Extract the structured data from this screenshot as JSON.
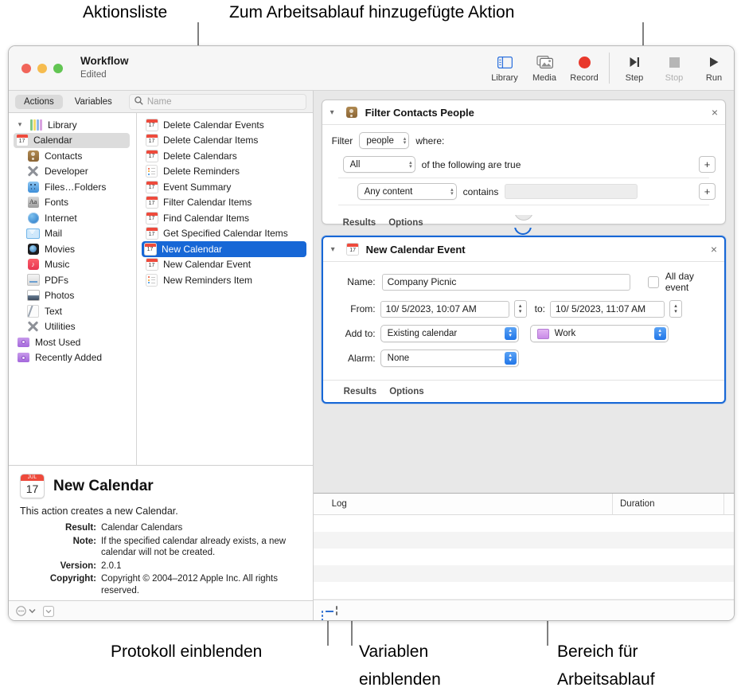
{
  "callouts": {
    "top_left": "Aktionsliste",
    "top_right": "Zum Arbeitsablauf hinzugefügte Aktion",
    "bottom_left": "Protokoll einblenden",
    "bottom_mid_line1": "Variablen",
    "bottom_mid_line2": "einblenden",
    "bottom_right_line1": "Bereich für",
    "bottom_right_line2": "Arbeitsablauf"
  },
  "window": {
    "title": "Workflow",
    "subtitle": "Edited",
    "traffic_lights": [
      "close-red",
      "minimize-yellow",
      "zoom-green"
    ],
    "toolbar": [
      {
        "label": "Library",
        "icon": "library-panel-icon",
        "disabled": false
      },
      {
        "label": "Media",
        "icon": "media-photos-icon",
        "disabled": false
      },
      {
        "label": "Record",
        "icon": "record-dot-icon",
        "disabled": false
      },
      {
        "label": "Step",
        "icon": "step-forward-icon",
        "disabled": false
      },
      {
        "label": "Stop",
        "icon": "stop-square-icon",
        "disabled": true
      },
      {
        "label": "Run",
        "icon": "play-triangle-icon",
        "disabled": false
      }
    ]
  },
  "library": {
    "tabs": [
      {
        "label": "Actions",
        "active": true
      },
      {
        "label": "Variables",
        "active": false
      }
    ],
    "search_placeholder": "Name",
    "search_value": "",
    "categories": [
      {
        "label": "Library",
        "icon": "library-books-icon",
        "level": 0,
        "expanded": true,
        "selected": false
      },
      {
        "label": "Calendar",
        "icon": "calendar-icon",
        "level": 1,
        "selected": true
      },
      {
        "label": "Contacts",
        "icon": "contacts-icon",
        "level": 1,
        "selected": false
      },
      {
        "label": "Developer",
        "icon": "developer-icon",
        "level": 1,
        "selected": false
      },
      {
        "label": "Files…Folders",
        "icon": "finder-icon",
        "level": 1,
        "selected": false
      },
      {
        "label": "Fonts",
        "icon": "fonts-icon",
        "level": 1,
        "selected": false
      },
      {
        "label": "Internet",
        "icon": "internet-globe-icon",
        "level": 1,
        "selected": false
      },
      {
        "label": "Mail",
        "icon": "mail-icon",
        "level": 1,
        "selected": false
      },
      {
        "label": "Movies",
        "icon": "movies-icon",
        "level": 1,
        "selected": false
      },
      {
        "label": "Music",
        "icon": "music-icon",
        "level": 1,
        "selected": false
      },
      {
        "label": "PDFs",
        "icon": "pdf-icon",
        "level": 1,
        "selected": false
      },
      {
        "label": "Photos",
        "icon": "photos-icon",
        "level": 1,
        "selected": false
      },
      {
        "label": "Text",
        "icon": "text-icon",
        "level": 1,
        "selected": false
      },
      {
        "label": "Utilities",
        "icon": "utilities-icon",
        "level": 1,
        "selected": false
      },
      {
        "label": "Most Used",
        "icon": "smart-folder-icon",
        "level": 0,
        "selected": false
      },
      {
        "label": "Recently Added",
        "icon": "smart-folder-icon",
        "level": 0,
        "selected": false
      }
    ],
    "actions": [
      {
        "label": "Delete Calendar Events",
        "icon": "calendar-icon",
        "selected": false
      },
      {
        "label": "Delete Calendar Items",
        "icon": "calendar-icon",
        "selected": false
      },
      {
        "label": "Delete Calendars",
        "icon": "calendar-icon",
        "selected": false
      },
      {
        "label": "Delete Reminders",
        "icon": "reminders-icon",
        "selected": false
      },
      {
        "label": "Event Summary",
        "icon": "calendar-icon",
        "selected": false
      },
      {
        "label": "Filter Calendar Items",
        "icon": "calendar-icon",
        "selected": false
      },
      {
        "label": "Find Calendar Items",
        "icon": "calendar-icon",
        "selected": false
      },
      {
        "label": "Get Specified Calendar Items",
        "icon": "calendar-icon",
        "selected": false
      },
      {
        "label": "New Calendar",
        "icon": "calendar-icon",
        "selected": true
      },
      {
        "label": "New Calendar Event",
        "icon": "calendar-icon",
        "selected": false
      },
      {
        "label": "New Reminders Item",
        "icon": "reminders-icon",
        "selected": false
      }
    ]
  },
  "description": {
    "icon_month": "JUL",
    "icon_day": "17",
    "title": "New Calendar",
    "lead": "This action creates a new Calendar.",
    "fields": [
      {
        "key": "Result:",
        "value": "Calendar Calendars"
      },
      {
        "key": "Note:",
        "value": "If the specified calendar already exists, a new calendar will not be created."
      },
      {
        "key": "Version:",
        "value": "2.0.1"
      },
      {
        "key": "Copyright:",
        "value": "Copyright © 2004–2012 Apple Inc.  All rights reserved."
      }
    ]
  },
  "workflow": {
    "filter_action": {
      "title": "Filter Contacts People",
      "icon": "contacts-icon",
      "filter_label": "Filter",
      "filter_target": "people",
      "where_label": "where:",
      "match_mode": "All",
      "match_suffix": "of the following are true",
      "condition_field": "Any content",
      "condition_operator": "contains",
      "condition_value": "",
      "add_group_button": "+",
      "add_condition_button": "+",
      "footer_tabs": [
        "Results",
        "Options"
      ],
      "close_button": "×"
    },
    "event_action": {
      "title": "New Calendar Event",
      "icon": "calendar-icon",
      "selected": true,
      "name_label": "Name:",
      "name_value": "Company Picnic",
      "all_day_label": "All day event",
      "all_day_checked": false,
      "from_label": "From:",
      "from_value": "10/  5/2023, 10:07 AM",
      "to_label": "to:",
      "to_value": "10/  5/2023, 11:07 AM",
      "add_to_label": "Add to:",
      "add_to_value": "Existing calendar",
      "calendar_value": "Work",
      "calendar_swatch": "#c98ae8",
      "alarm_label": "Alarm:",
      "alarm_value": "None",
      "footer_tabs": [
        "Results",
        "Options"
      ],
      "close_button": "×"
    }
  },
  "log": {
    "columns": [
      "Log",
      "",
      "Duration",
      ""
    ],
    "rows": [],
    "footer_buttons": [
      {
        "icon": "show-log-icon",
        "active": true
      },
      {
        "icon": "show-variables-icon",
        "active": false
      }
    ]
  },
  "colors": {
    "accent_blue": "#1767d6",
    "record_red": "#e8392c",
    "selection_grey": "#dcdcdc"
  }
}
